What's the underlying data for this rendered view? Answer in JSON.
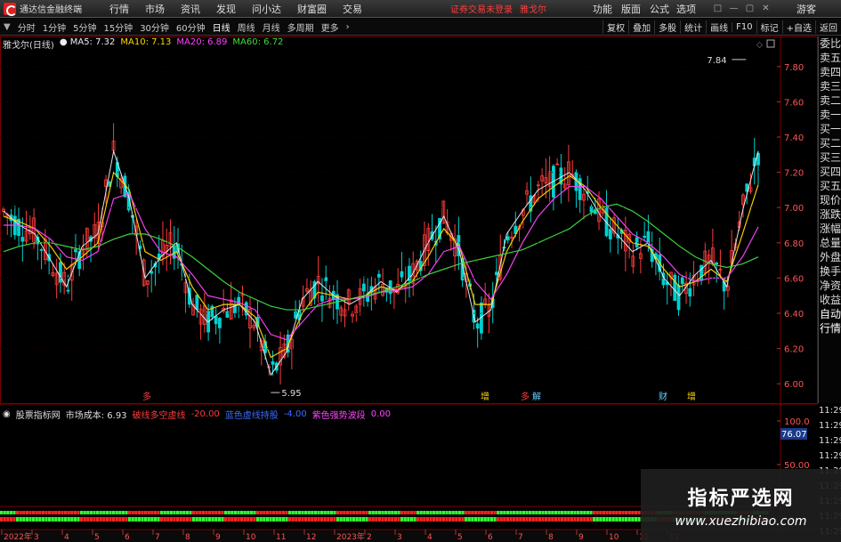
{
  "app": {
    "title": "通达信金融终端",
    "login_note": "证券交易未登录",
    "stock_name": "雅戈尔"
  },
  "menu": [
    "行情",
    "市场",
    "资讯",
    "发现",
    "问小达",
    "财富圈",
    "交易"
  ],
  "right_menu": [
    "功能",
    "版面",
    "公式",
    "选项",
    "游客"
  ],
  "periods": [
    "分时",
    "1分钟",
    "5分钟",
    "15分钟",
    "30分钟",
    "60分钟",
    "日线",
    "周线",
    "月线",
    "多周期",
    "更多"
  ],
  "active_period": "日线",
  "tools": [
    "复权",
    "叠加",
    "多股",
    "统计",
    "画线",
    "F10",
    "标记",
    "+自选",
    "返回"
  ],
  "legend": {
    "stock": "雅戈尔(日线)",
    "ma5": "MA5: 7.32",
    "ma10": "MA10: 7.13",
    "ma20": "MA20: 6.89",
    "ma60": "MA60: 6.72"
  },
  "price_axis": [
    "7.80",
    "7.60",
    "7.40",
    "7.20",
    "7.00",
    "6.80",
    "6.60",
    "6.40",
    "6.20",
    "6.00"
  ],
  "high_label": "7.84",
  "low_label": "5.95",
  "event_marks": [
    {
      "text": "多",
      "color": "#ff3b3b"
    },
    {
      "text": "增",
      "color": "#ffd700"
    },
    {
      "text": "多",
      "color": "#ff3b3b"
    },
    {
      "text": "解",
      "color": "#66ccff"
    },
    {
      "text": "财",
      "color": "#66ccff"
    },
    {
      "text": "增",
      "color": "#ffd700"
    }
  ],
  "indicator": {
    "name": "股票指标网",
    "cost": "市场成本: 6.93",
    "line1": "破线多空虚线",
    "line1_val": "-20.00",
    "line2": "蓝色虚线持股",
    "line2_val": "-4.00",
    "line3": "紫色强势波段",
    "line3_val": "0.00",
    "axis": [
      "100.0",
      "76.07",
      "50.00"
    ]
  },
  "side_panel": [
    "委比",
    "卖五",
    "卖四",
    "卖三",
    "卖二",
    "卖一",
    "买一",
    "买二",
    "买三",
    "买四",
    "买五",
    "现价",
    "涨跌",
    "涨幅",
    "总量",
    "外盘",
    "换手",
    "净资",
    "收益",
    "自动",
    "行情"
  ],
  "time_column": [
    "11:29",
    "11:29",
    "11:29",
    "11:29",
    "11:29",
    "11:29",
    "11:29",
    "11:29",
    "11:29"
  ],
  "date_axis": [
    "2022年",
    "3",
    "4",
    "5",
    "6",
    "7",
    "8",
    "9",
    "10",
    "11",
    "12",
    "2023年",
    "2",
    "3",
    "4",
    "5",
    "6",
    "7",
    "8",
    "9",
    "10",
    "11",
    "12"
  ],
  "watermark": {
    "title": "指标严选网",
    "url": "www.xuezhibiao.com"
  },
  "colors": {
    "up": "#ff3b3b",
    "down": "#00d0d0",
    "ma5": "#eeeeee",
    "ma10": "#ffd700",
    "ma20": "#ff44ff",
    "ma60": "#3fdc3f"
  },
  "chart_data": {
    "type": "line",
    "title": "雅戈尔(日线)",
    "ylim": [
      5.9,
      7.9
    ],
    "x": [
      0,
      5,
      10,
      15,
      20,
      25,
      30,
      35,
      40,
      45,
      50,
      55,
      60,
      65,
      70,
      75,
      80,
      85,
      90,
      95,
      100,
      105,
      110,
      115,
      120,
      125,
      130,
      135,
      140,
      145,
      150,
      155,
      160,
      165,
      170,
      175,
      180,
      185,
      190,
      195,
      200,
      205,
      210,
      215,
      220,
      225,
      230,
      235,
      240
    ],
    "series": [
      {
        "name": "MA5",
        "values": [
          6.98,
          6.9,
          6.85,
          6.7,
          6.55,
          6.78,
          6.85,
          7.32,
          7.05,
          6.6,
          6.72,
          6.8,
          6.45,
          6.35,
          6.42,
          6.45,
          6.35,
          6.05,
          6.18,
          6.48,
          6.58,
          6.5,
          6.45,
          6.5,
          6.58,
          6.52,
          6.62,
          6.8,
          6.95,
          6.75,
          6.35,
          6.42,
          6.85,
          6.98,
          7.1,
          7.15,
          7.2,
          7.1,
          6.95,
          6.85,
          6.75,
          6.8,
          6.6,
          6.5,
          6.62,
          6.7,
          6.55,
          6.98,
          7.32
        ]
      },
      {
        "name": "MA10",
        "values": [
          6.95,
          6.92,
          6.88,
          6.78,
          6.65,
          6.72,
          6.8,
          7.2,
          7.1,
          6.75,
          6.7,
          6.75,
          6.55,
          6.42,
          6.45,
          6.45,
          6.38,
          6.15,
          6.2,
          6.4,
          6.52,
          6.5,
          6.48,
          6.5,
          6.55,
          6.53,
          6.58,
          6.72,
          6.88,
          6.78,
          6.45,
          6.45,
          6.75,
          6.92,
          7.05,
          7.12,
          7.18,
          7.12,
          7.0,
          6.9,
          6.8,
          6.78,
          6.65,
          6.55,
          6.58,
          6.65,
          6.58,
          6.85,
          7.13
        ]
      },
      {
        "name": "MA20",
        "values": [
          6.9,
          6.9,
          6.88,
          6.82,
          6.72,
          6.7,
          6.75,
          7.05,
          7.08,
          6.88,
          6.75,
          6.72,
          6.62,
          6.5,
          6.48,
          6.46,
          6.42,
          6.28,
          6.25,
          6.35,
          6.45,
          6.48,
          6.48,
          6.49,
          6.52,
          6.53,
          6.55,
          6.62,
          6.75,
          6.78,
          6.58,
          6.48,
          6.62,
          6.8,
          6.95,
          7.05,
          7.12,
          7.12,
          7.05,
          6.95,
          6.85,
          6.8,
          6.72,
          6.62,
          6.58,
          6.6,
          6.6,
          6.72,
          6.89
        ]
      },
      {
        "name": "MA60",
        "values": [
          6.75,
          6.78,
          6.8,
          6.8,
          6.78,
          6.76,
          6.78,
          6.82,
          6.85,
          6.85,
          6.82,
          6.78,
          6.72,
          6.65,
          6.58,
          6.52,
          6.48,
          6.44,
          6.42,
          6.42,
          6.44,
          6.46,
          6.48,
          6.5,
          6.52,
          6.55,
          6.58,
          6.62,
          6.65,
          6.68,
          6.7,
          6.72,
          6.74,
          6.76,
          6.8,
          6.84,
          6.88,
          6.95,
          7.0,
          7.02,
          6.98,
          6.92,
          6.85,
          6.78,
          6.72,
          6.68,
          6.66,
          6.68,
          6.72
        ]
      }
    ]
  }
}
